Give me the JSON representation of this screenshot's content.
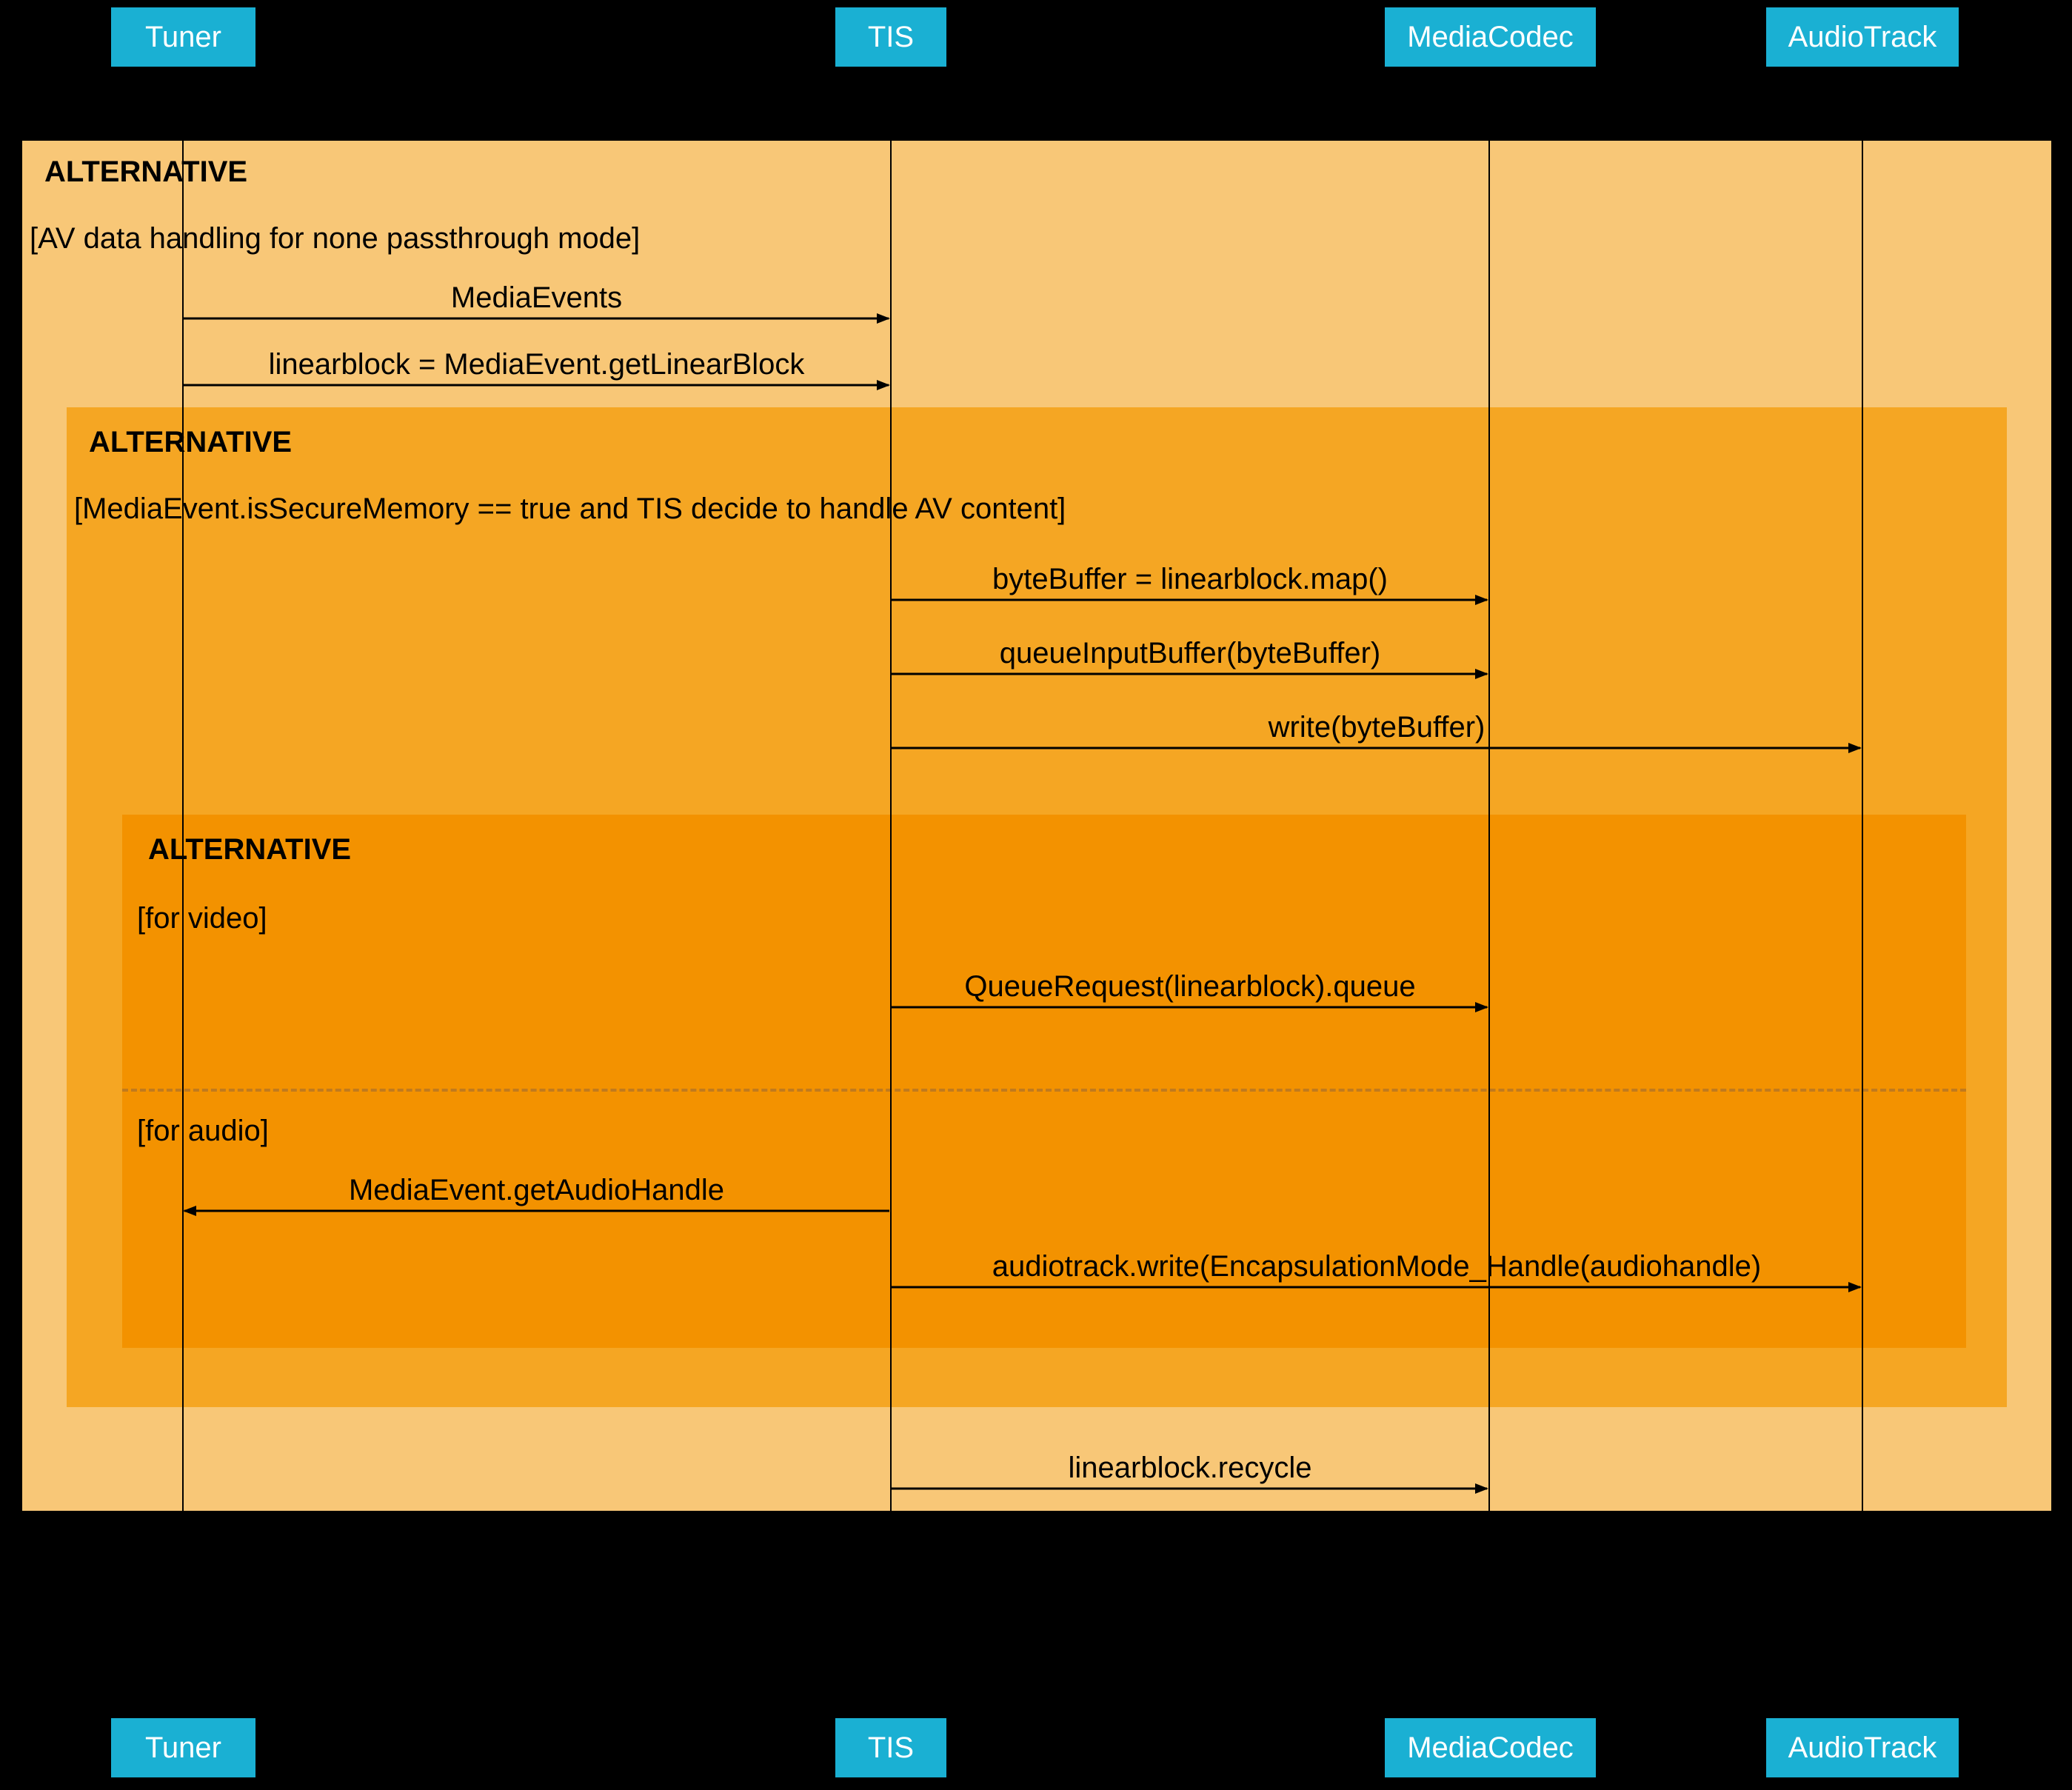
{
  "actors": {
    "tuner": "Tuner",
    "tis": "TIS",
    "mediacodec": "MediaCodec",
    "audiotrack": "AudioTrack"
  },
  "alt_outer": {
    "header": "ALTERNATIVE",
    "cond": "[AV data handling for none passthrough mode]"
  },
  "alt_mid": {
    "header": "ALTERNATIVE",
    "cond": "[MediaEvent.isSecureMemory == true and TIS decide to handle AV content]"
  },
  "alt_inner": {
    "header": "ALTERNATIVE",
    "cond_video": "[for video]",
    "cond_audio": "[for audio]"
  },
  "messages": {
    "m1": "MediaEvents",
    "m2": "linearblock = MediaEvent.getLinearBlock",
    "m3": "byteBuffer = linearblock.map()",
    "m4": "queueInputBuffer(byteBuffer)",
    "m5": "write(byteBuffer)",
    "m6": "QueueRequest(linearblock).queue",
    "m7": "MediaEvent.getAudioHandle",
    "m8": "audiotrack.write(EncapsulationMode_Handle(audiohandle)",
    "m9": "linearblock.recycle"
  },
  "chart_data": {
    "type": "sequence-diagram",
    "actors": [
      "Tuner",
      "TIS",
      "MediaCodec",
      "AudioTrack"
    ],
    "blocks": [
      {
        "type": "alt",
        "label": "ALTERNATIVE",
        "condition": "AV data handling for none passthrough mode",
        "contents": [
          {
            "from": "Tuner",
            "to": "TIS",
            "text": "MediaEvents"
          },
          {
            "from": "Tuner",
            "to": "TIS",
            "text": "linearblock = MediaEvent.getLinearBlock"
          },
          {
            "type": "alt",
            "label": "ALTERNATIVE",
            "condition": "MediaEvent.isSecureMemory == true and TIS decide to handle AV content",
            "contents": [
              {
                "from": "TIS",
                "to": "MediaCodec",
                "text": "byteBuffer = linearblock.map()"
              },
              {
                "from": "TIS",
                "to": "MediaCodec",
                "text": "queueInputBuffer(byteBuffer)"
              },
              {
                "from": "TIS",
                "to": "AudioTrack",
                "text": "write(byteBuffer)"
              },
              {
                "type": "alt",
                "label": "ALTERNATIVE",
                "branches": [
                  {
                    "condition": "for video",
                    "contents": [
                      {
                        "from": "TIS",
                        "to": "MediaCodec",
                        "text": "QueueRequest(linearblock).queue"
                      }
                    ]
                  },
                  {
                    "condition": "for audio",
                    "contents": [
                      {
                        "from": "TIS",
                        "to": "Tuner",
                        "text": "MediaEvent.getAudioHandle"
                      },
                      {
                        "from": "TIS",
                        "to": "AudioTrack",
                        "text": "audiotrack.write(EncapsulationMode_Handle(audiohandle)"
                      }
                    ]
                  }
                ]
              }
            ]
          },
          {
            "from": "TIS",
            "to": "MediaCodec",
            "text": "linearblock.recycle"
          }
        ]
      }
    ]
  }
}
